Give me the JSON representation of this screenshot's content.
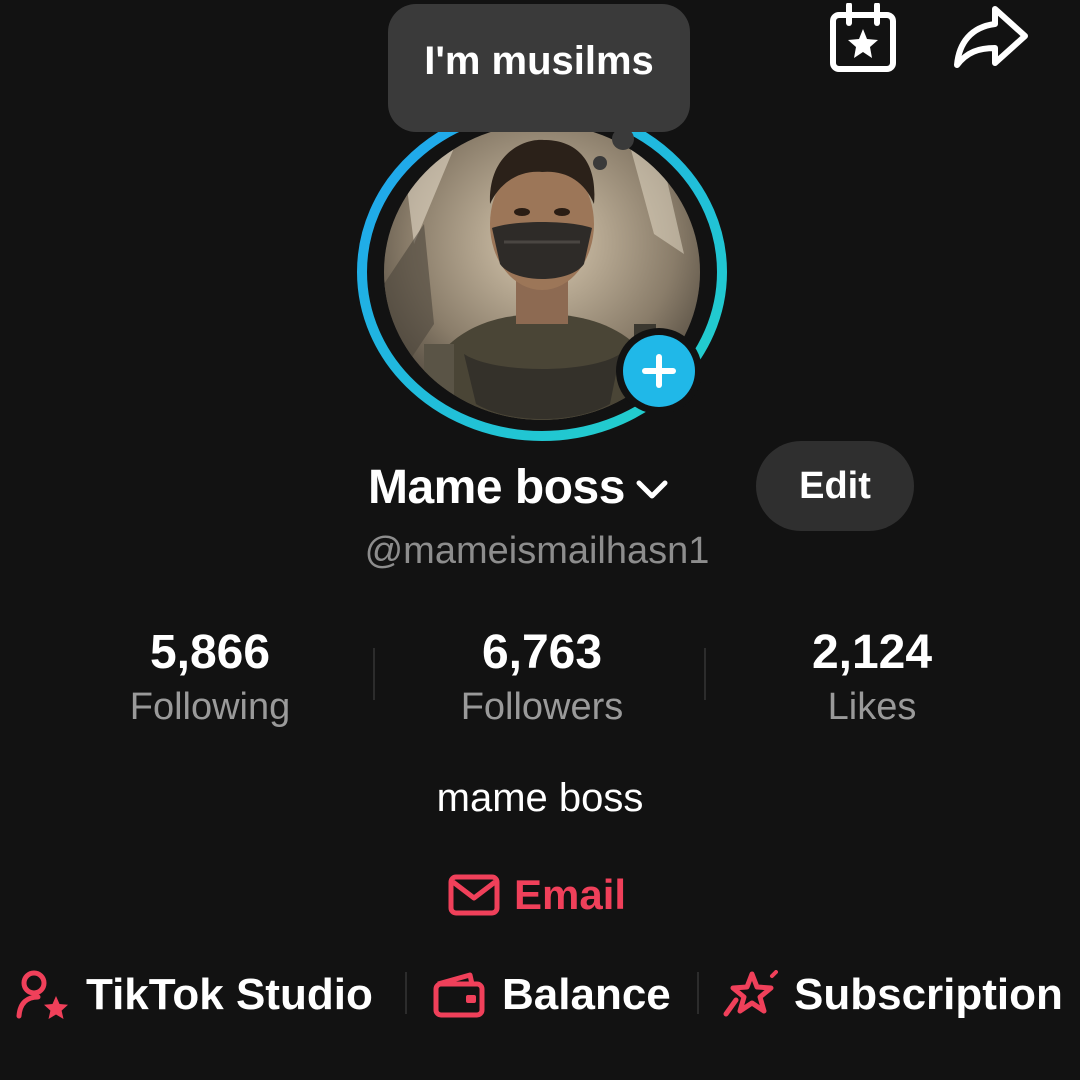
{
  "note": {
    "text": "I'm musilms"
  },
  "profile": {
    "display_name": "Mame boss",
    "username": "@mameismailhasn1",
    "edit_label": "Edit",
    "bio": "mame boss",
    "email_label": "Email"
  },
  "stats": [
    {
      "value": "5,866",
      "label": "Following"
    },
    {
      "value": "6,763",
      "label": "Followers"
    },
    {
      "value": "2,124",
      "label": "Likes"
    }
  ],
  "bottom_links": [
    {
      "label": "TikTok Studio",
      "icon": "person-star-icon"
    },
    {
      "label": "Balance",
      "icon": "wallet-icon"
    },
    {
      "label": "Subscription",
      "icon": "star-ribbon-icon"
    }
  ],
  "icons": {
    "top_left": "calendar-star-icon",
    "top_right": "share-arrow-icon",
    "add_badge": "plus-icon",
    "name_dropdown": "chevron-down-icon",
    "email": "mail-icon"
  },
  "colors": {
    "background": "#121212",
    "accent_red": "#f0405a",
    "ring_blue": "#1fa3f0",
    "ring_teal": "#22d3c8",
    "badge_blue": "#20b8e8"
  }
}
